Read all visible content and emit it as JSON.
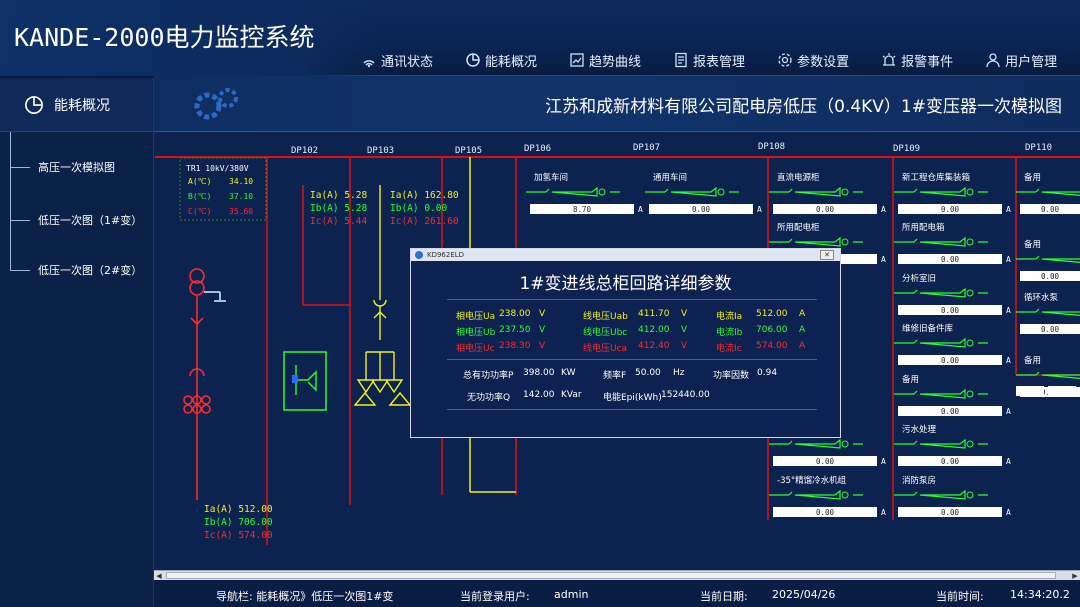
{
  "app": {
    "title": "KANDE-2000电力监控系统"
  },
  "nav": [
    {
      "label": "通讯状态",
      "icon": "signal-icon"
    },
    {
      "label": "能耗概况",
      "icon": "pie-icon"
    },
    {
      "label": "趋势曲线",
      "icon": "trend-icon"
    },
    {
      "label": "报表管理",
      "icon": "report-icon"
    },
    {
      "label": "参数设置",
      "icon": "gear-icon"
    },
    {
      "label": "报警事件",
      "icon": "alarm-icon"
    },
    {
      "label": "用户管理",
      "icon": "user-icon"
    }
  ],
  "sidebar": {
    "header": "能耗概况",
    "items": [
      "高压一次模拟图",
      "低压一次图（1#变）",
      "低压一次图（2#变）"
    ]
  },
  "page_title": "江苏和成新材料有限公司配电房低压（0.4KV）1#变压器一次模拟图",
  "colors": {
    "red": "#ff2a2a",
    "green": "#2cff2c",
    "yellow": "#f2f21a",
    "line": "#d11"
  },
  "diagram": {
    "tr": {
      "title": "TR1 10kV/380V",
      "a": "A(℃)",
      "b": "B(℃)",
      "c": "C(℃)",
      "va": "34.10",
      "vb": "37.10",
      "vc": "35.60"
    },
    "dp": [
      "DP102",
      "DP103",
      "DP105",
      "DP106",
      "DP107",
      "DP108",
      "DP109",
      "DP110"
    ],
    "dp102": {
      "a": "Ia(A) 5.28",
      "b": "Ib(A) 5.28",
      "c": "Ic(A) 5.44"
    },
    "dp103": {
      "a": "Ia(A) 162.80",
      "b": "Ib(A) 0.00",
      "c": "Ic(A) 261.60"
    },
    "main_i": {
      "a": "Ia(A) 512.00",
      "b": "Ib(A) 706.00",
      "c": "Ic(A) 574.00"
    },
    "feeders": [
      {
        "name": "加氢车间",
        "val": "8.70"
      },
      {
        "name": "通用车间",
        "val": "0.00"
      },
      {
        "name": "直流电源柜",
        "val": "0.00"
      },
      {
        "name": "所用配电柜",
        "val": "0.00"
      },
      {
        "name": "新工程仓库集装箱",
        "val": "0.00"
      },
      {
        "name": "所用配电箱",
        "val": "0.00"
      },
      {
        "name": "分析室旧",
        "val": "0.00"
      },
      {
        "name": "维修旧备件库",
        "val": "0.00"
      },
      {
        "name": "备用",
        "val": "0.00"
      },
      {
        "name": "污水处理",
        "val": "0.00"
      },
      {
        "name": "消防泵房",
        "val": "0.00"
      },
      {
        "name": "-35°精馏冷水机组",
        "val": "0.00"
      },
      {
        "name": "组",
        "val": "0.00"
      },
      {
        "name": "备用",
        "val": "0.00"
      },
      {
        "name": "备用",
        "val": "0.00"
      },
      {
        "name": "循环水泵",
        "val": "0.00"
      },
      {
        "name": "备用",
        "val": "0.00"
      }
    ],
    "unit": "A"
  },
  "popup": {
    "bar": "KD962ELD",
    "title": "1#变进线总柜回路详细参数",
    "r1": [
      "相电压Ua",
      "238.00",
      "V",
      "线电压Uab",
      "411.70",
      "V",
      "电流Ia",
      "512.00",
      "A"
    ],
    "r2": [
      "相电压Ub",
      "237.50",
      "V",
      "线电压Ubc",
      "412.00",
      "V",
      "电流Ib",
      "706.00",
      "A"
    ],
    "r3": [
      "相电压Uc",
      "238.30",
      "V",
      "线电压Uca",
      "412.40",
      "V",
      "电流Ic",
      "574.00",
      "A"
    ],
    "p1": [
      "总有功功率P",
      "398.00",
      "KW",
      "频率F",
      "50.00",
      "Hz",
      "功率因数",
      "0.94"
    ],
    "p2": [
      "无功功率Q",
      "142.00",
      "KVar",
      "电能Epi(kWh)",
      "152440.00"
    ]
  },
  "status": {
    "nav": "导航栏: 能耗概况》低压一次图1#变",
    "user_label": "当前登录用户:",
    "user": "admin",
    "date_label": "当前日期:",
    "date": "2025/04/26",
    "time_label": "当前时间:",
    "time": "14:34:20.2"
  }
}
